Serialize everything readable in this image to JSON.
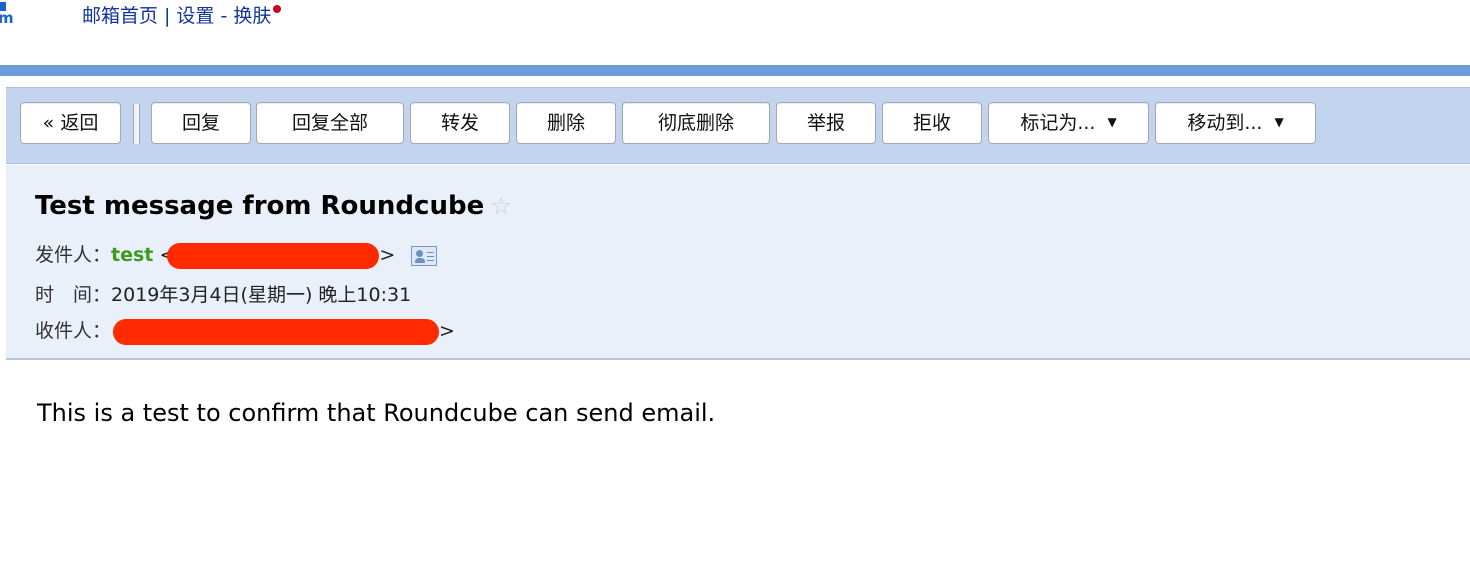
{
  "top_nav": {
    "logo_fragment": "m",
    "home_link": "邮箱首页",
    "separator": "|",
    "settings_link": "设置",
    "dash": "-",
    "skin_link": "换肤"
  },
  "toolbar": {
    "back_label": "« 返回",
    "reply_label": "回复",
    "reply_all_label": "回复全部",
    "forward_label": "转发",
    "delete_label": "删除",
    "delete_permanently_label": "彻底删除",
    "report_label": "举报",
    "reject_label": "拒收",
    "mark_as_label": "标记为...",
    "move_to_label": "移动到...",
    "dropdown_caret": "▼"
  },
  "message": {
    "subject": "Test message from Roundcube",
    "star_icon": "☆",
    "from_label": "发件人：",
    "from_name": "test",
    "from_open": "<",
    "from_close": ">",
    "time_label": "时　间：",
    "time_value": "2019年3月4日(星期一) 晚上10:31",
    "to_label": "收件人：",
    "to_close": ">",
    "body": "This is a test to confirm that Roundcube can send email."
  },
  "colors": {
    "nav_link": "#12369c",
    "blue_rule": "#6d9cd9",
    "toolbar_bg": "#c2d4ee",
    "header_bg": "#e9f0f9",
    "sender_name": "#3c9a1f",
    "redaction": "#ff2a00",
    "unread_dot": "#d0021b"
  }
}
